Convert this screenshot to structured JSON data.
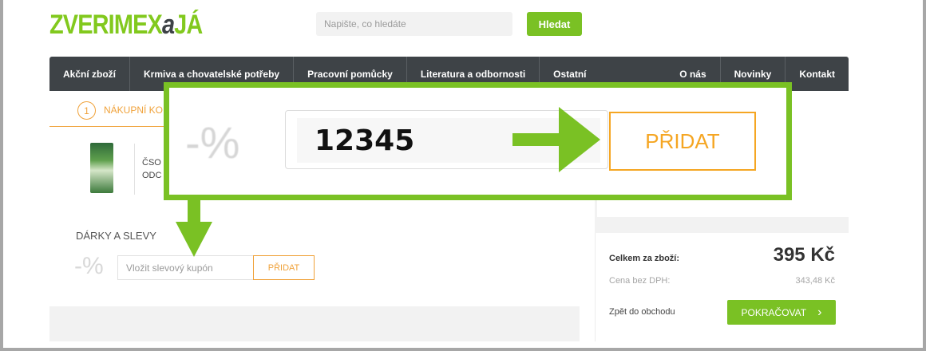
{
  "header": {
    "logo_main": "ZVERIMEX",
    "logo_a": "a",
    "logo_ja": "JÁ",
    "search_placeholder": "Napište, co hledáte",
    "search_button": "Hledat"
  },
  "nav": {
    "left_items": [
      "Akční zboží",
      "Krmiva a chovatelské potřeby",
      "Pracovní pomůcky",
      "Literatura a odbornosti",
      "Ostatní"
    ],
    "right_items": [
      "O nás",
      "Novinky",
      "Kontakt"
    ]
  },
  "steps": {
    "number": "1",
    "label": "NÁKUPNÍ KO"
  },
  "product": {
    "name_line1": "ČSO",
    "name_line2": "ODC"
  },
  "discounts": {
    "title": "DÁRKY A SLEVY",
    "percent_icon": "-%",
    "coupon_placeholder": "Vložit slevový kupón",
    "add_button": "PŘIDAT"
  },
  "summary": {
    "total_label": "Celkem za zboží:",
    "total_price": "395 Kč",
    "net_label": "Cena bez DPH:",
    "net_price": "343,48 Kč",
    "back_link": "Zpět do obchodu",
    "continue_button": "POKRAČOVAT",
    "continue_icon": "›"
  },
  "zoom_callout": {
    "percent_icon": "-%",
    "coupon_code": "12345",
    "add_button": "PŘIDAT"
  },
  "colors": {
    "brand_green": "#7ac124",
    "accent_orange": "#f5a623",
    "nav_dark": "#3e4347"
  }
}
